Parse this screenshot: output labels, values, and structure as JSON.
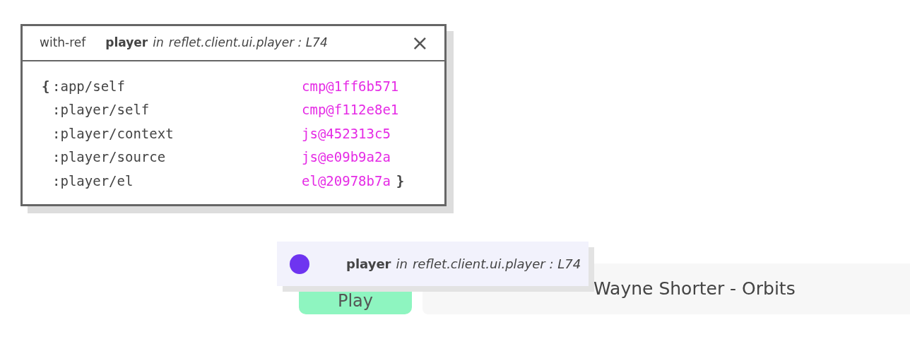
{
  "inspector": {
    "tab": "with-ref",
    "component": "player",
    "connector": "in",
    "namespace": "reflet.client.ui.player",
    "separator": ":",
    "line": "L74",
    "close": "×",
    "open_brace": "{",
    "close_brace": "}",
    "entries": [
      {
        "key": ":app/self",
        "value": "cmp@1ff6b571"
      },
      {
        "key": ":player/self",
        "value": "cmp@f112e8e1"
      },
      {
        "key": ":player/context",
        "value": "js@452313c5"
      },
      {
        "key": ":player/source",
        "value": "js@e09b9a2a"
      },
      {
        "key": ":player/el",
        "value": "el@20978b7a"
      }
    ]
  },
  "tooltip": {
    "color": "#6e34f0",
    "component": "player",
    "connector": "in",
    "namespace": "reflet.client.ui.player",
    "separator": ":",
    "line": "L74"
  },
  "player": {
    "button": "Play",
    "track": "Wayne Shorter - Orbits"
  }
}
